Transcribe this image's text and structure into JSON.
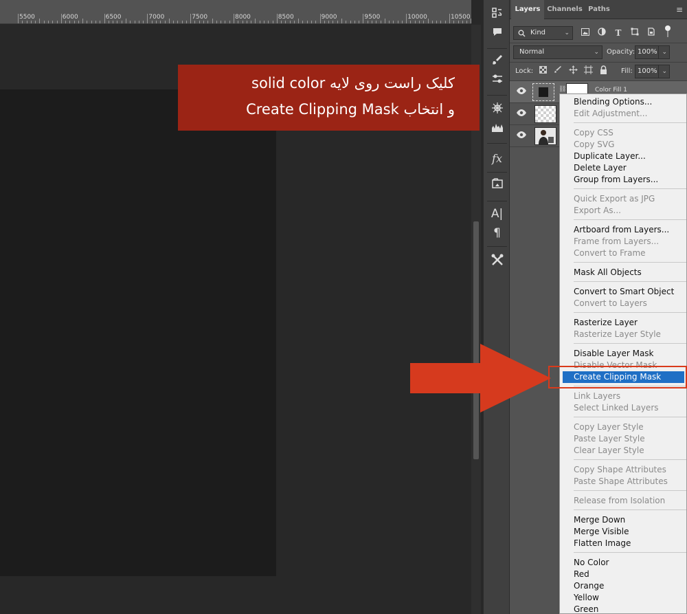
{
  "ruler": {
    "labels": [
      "5500",
      "6000",
      "6500",
      "7000",
      "7500",
      "8000",
      "8500",
      "9000",
      "9500",
      "10000",
      "10500"
    ]
  },
  "annotation": {
    "line1": "کلیک راست روی لایه solid color",
    "line2": "و انتخاب Create Clipping Mask",
    "background": "#9b2415"
  },
  "toolstrip": {
    "tools": [
      "history-brush-icon",
      "comment-icon",
      "brush-settings-icon",
      "adjust-sliders-icon",
      "navigator-wheel-icon",
      "histogram-icon",
      "fx-icon",
      "libraries-icon",
      "character-icon",
      "paragraph-icon",
      "tools-icon"
    ]
  },
  "panel": {
    "tabs": [
      "Layers",
      "Channels",
      "Paths"
    ],
    "active_tab": "Layers",
    "filter": {
      "label": "Kind"
    },
    "blend_mode": "Normal",
    "opacity_label": "Opacity:",
    "opacity_value": "100%",
    "lock_label": "Lock:",
    "fill_label": "Fill:",
    "fill_value": "100%",
    "layers": [
      {
        "name": "Color Fill 1",
        "type": "fill"
      },
      {
        "name": "",
        "type": "transparent"
      },
      {
        "name": "",
        "type": "photo"
      }
    ]
  },
  "context_menu": {
    "groups": [
      [
        {
          "label": "Blending Options...",
          "enabled": true
        },
        {
          "label": "Edit Adjustment...",
          "enabled": false
        }
      ],
      [
        {
          "label": "Copy CSS",
          "enabled": false
        },
        {
          "label": "Copy SVG",
          "enabled": false
        },
        {
          "label": "Duplicate Layer...",
          "enabled": true
        },
        {
          "label": "Delete Layer",
          "enabled": true
        },
        {
          "label": "Group from Layers...",
          "enabled": true
        }
      ],
      [
        {
          "label": "Quick Export as JPG",
          "enabled": false
        },
        {
          "label": "Export As...",
          "enabled": false
        }
      ],
      [
        {
          "label": "Artboard from Layers...",
          "enabled": true
        },
        {
          "label": "Frame from Layers...",
          "enabled": false
        },
        {
          "label": "Convert to Frame",
          "enabled": false
        }
      ],
      [
        {
          "label": "Mask All Objects",
          "enabled": true
        }
      ],
      [
        {
          "label": "Convert to Smart Object",
          "enabled": true
        },
        {
          "label": "Convert to Layers",
          "enabled": false
        }
      ],
      [
        {
          "label": "Rasterize Layer",
          "enabled": true
        },
        {
          "label": "Rasterize Layer Style",
          "enabled": false
        }
      ],
      [
        {
          "label": "Disable Layer Mask",
          "enabled": true
        },
        {
          "label": "Disable Vector Mask",
          "enabled": false
        },
        {
          "label": "Create Clipping Mask",
          "enabled": true,
          "highlighted": true
        }
      ],
      [
        {
          "label": "Link Layers",
          "enabled": false
        },
        {
          "label": "Select Linked Layers",
          "enabled": false
        }
      ],
      [
        {
          "label": "Copy Layer Style",
          "enabled": false
        },
        {
          "label": "Paste Layer Style",
          "enabled": false
        },
        {
          "label": "Clear Layer Style",
          "enabled": false
        }
      ],
      [
        {
          "label": "Copy Shape Attributes",
          "enabled": false
        },
        {
          "label": "Paste Shape Attributes",
          "enabled": false
        }
      ],
      [
        {
          "label": "Release from Isolation",
          "enabled": false
        }
      ],
      [
        {
          "label": "Merge Down",
          "enabled": true
        },
        {
          "label": "Merge Visible",
          "enabled": true
        },
        {
          "label": "Flatten Image",
          "enabled": true
        }
      ],
      [
        {
          "label": "No Color",
          "enabled": true
        },
        {
          "label": "Red",
          "enabled": true
        },
        {
          "label": "Orange",
          "enabled": true
        },
        {
          "label": "Yellow",
          "enabled": true
        },
        {
          "label": "Green",
          "enabled": true
        }
      ]
    ],
    "highlight_color": "#1f6fc5",
    "callout_color": "#d93a1b"
  }
}
